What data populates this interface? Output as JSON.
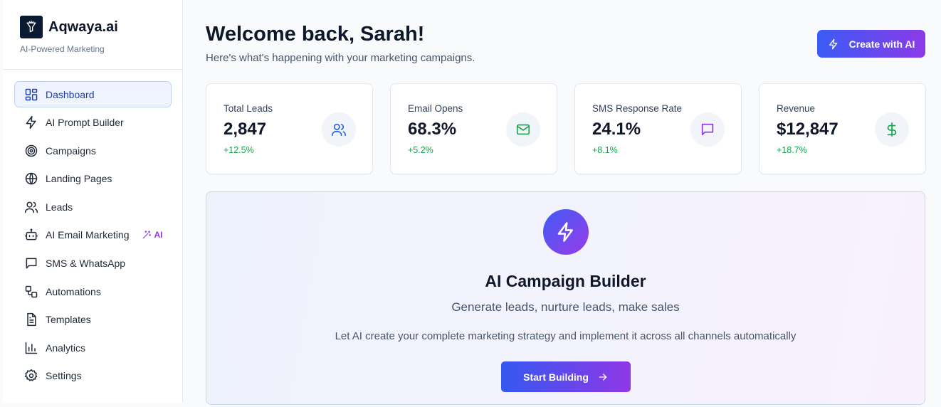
{
  "brand": {
    "name": "Aqwaya.ai",
    "tagline": "AI-Powered Marketing"
  },
  "sidebar": {
    "items": [
      {
        "label": "Dashboard",
        "icon": "dashboard-icon",
        "active": true
      },
      {
        "label": "AI Prompt Builder",
        "icon": "bolt-icon"
      },
      {
        "label": "Campaigns",
        "icon": "target-icon"
      },
      {
        "label": "Landing Pages",
        "icon": "globe-icon"
      },
      {
        "label": "Leads",
        "icon": "users-icon"
      },
      {
        "label": "AI Email Marketing",
        "icon": "bot-icon",
        "badge": "AI"
      },
      {
        "label": "SMS & WhatsApp",
        "icon": "message-icon"
      },
      {
        "label": "Automations",
        "icon": "workflow-icon"
      },
      {
        "label": "Templates",
        "icon": "file-icon"
      },
      {
        "label": "Analytics",
        "icon": "bar-chart-icon"
      },
      {
        "label": "Settings",
        "icon": "gear-icon"
      }
    ]
  },
  "header": {
    "title": "Welcome back, Sarah!",
    "subtitle": "Here's what's happening with your marketing campaigns.",
    "create_button": "Create with AI"
  },
  "stats": [
    {
      "label": "Total Leads",
      "value": "2,847",
      "delta": "+12.5%",
      "icon": "users-icon",
      "color": "#2563eb"
    },
    {
      "label": "Email Opens",
      "value": "68.3%",
      "delta": "+5.2%",
      "icon": "mail-icon",
      "color": "#16a34a"
    },
    {
      "label": "SMS Response Rate",
      "value": "24.1%",
      "delta": "+8.1%",
      "icon": "message-icon",
      "color": "#9333ea"
    },
    {
      "label": "Revenue",
      "value": "$12,847",
      "delta": "+18.7%",
      "icon": "dollar-icon",
      "color": "#16a34a"
    }
  ],
  "builder": {
    "title": "AI Campaign Builder",
    "subtitle": "Generate leads, nurture leads, make sales",
    "description": "Let AI create your complete marketing strategy and implement it across all channels automatically",
    "button": "Start Building"
  },
  "colors": {
    "accent_start": "#3b5bf5",
    "accent_end": "#8b3ae8",
    "positive": "#16a34a"
  }
}
